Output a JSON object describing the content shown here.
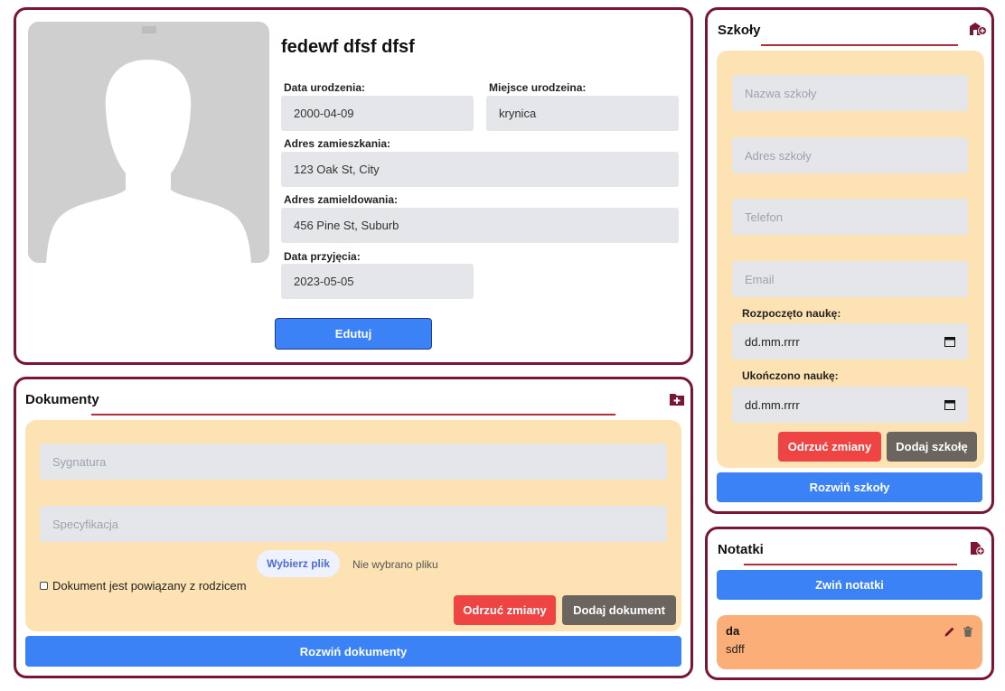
{
  "profile": {
    "name": "fedewf dfsf dfsf",
    "avatar_icon": "person-silhouette-icon",
    "birth_date_label": "Data urodzenia:",
    "birth_date": "2000-04-09",
    "birth_place_label": "Miejsce urodzeina:",
    "birth_place": "krynica",
    "residence_label": "Adres zamieszkania:",
    "residence": "123 Oak St, City",
    "registered_label": "Adres zamieldowania:",
    "registered": "456 Pine St, Suburb",
    "admission_label": "Data przyjęcia:",
    "admission": "2023-05-05",
    "edit_label": "Edutuj"
  },
  "documents": {
    "title": "Dokumenty",
    "add_icon": "folder-plus-icon",
    "signature_placeholder": "Sygnatura",
    "spec_placeholder": "Specyfikacja",
    "choose_file_label": "Wybierz plik",
    "no_file_label": "Nie wybrano pliku",
    "parent_checkbox_label": "Dokument jest powiązany z rodzicem",
    "discard_label": "Odrzuć zmiany",
    "add_label": "Dodaj dokument",
    "expand_label": "Rozwiń dokumenty"
  },
  "schools": {
    "title": "Szkoły",
    "add_icon": "school-plus-icon",
    "name_placeholder": "Nazwa szkoły",
    "address_placeholder": "Adres szkoły",
    "phone_placeholder": "Telefon",
    "email_placeholder": "Email",
    "started_label": "Rozpoczęto naukę:",
    "started_value": "dd.mm.rrrr",
    "finished_label": "Ukończono naukę:",
    "finished_value": "dd.mm.rrrr",
    "discard_label": "Odrzuć zmiany",
    "add_label": "Dodaj szkołę",
    "expand_label": "Rozwiń szkoły"
  },
  "notes": {
    "title": "Notatki",
    "add_icon": "file-plus-icon",
    "collapse_label": "Zwiń notatki",
    "items": [
      {
        "title": "da",
        "body": "sdff"
      }
    ]
  },
  "colors": {
    "border": "#7a1633",
    "accent_blue": "#3b82f6",
    "danger": "#ef4444",
    "neutral": "#6b6560",
    "panel": "#fde3b3",
    "note": "#fbae78"
  }
}
